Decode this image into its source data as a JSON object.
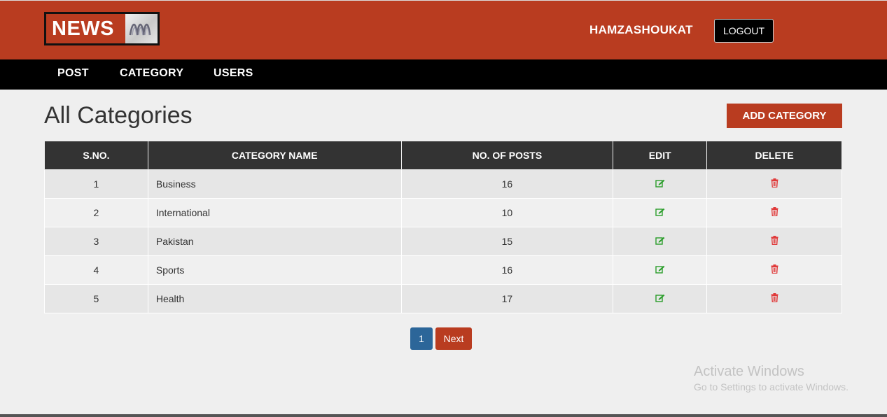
{
  "header": {
    "logo_text": "NEWS",
    "logo_mark": "ABC-style ribbon logo",
    "username": "HAMZASHOUKAT",
    "logout_label": "LOGOUT",
    "brand_color": "#b93c20"
  },
  "nav": {
    "items": [
      {
        "label": "POST"
      },
      {
        "label": "CATEGORY"
      },
      {
        "label": "USERS"
      }
    ]
  },
  "main": {
    "title": "All Categories",
    "add_button_label": "ADD CATEGORY",
    "table": {
      "columns": [
        "S.NO.",
        "CATEGORY NAME",
        "NO. OF POSTS",
        "EDIT",
        "DELETE"
      ],
      "rows": [
        {
          "sno": "1",
          "name": "Business",
          "posts": "16"
        },
        {
          "sno": "2",
          "name": "International",
          "posts": "10"
        },
        {
          "sno": "3",
          "name": "Pakistan",
          "posts": "15"
        },
        {
          "sno": "4",
          "name": "Sports",
          "posts": "16"
        },
        {
          "sno": "5",
          "name": "Health",
          "posts": "17"
        }
      ],
      "edit_icon": "edit-icon",
      "delete_icon": "trash-icon"
    },
    "pagination": {
      "current_page": "1",
      "next_label": "Next",
      "active_color": "#2c6699"
    }
  },
  "watermark": {
    "title": "Activate Windows",
    "subtitle": "Go to Settings to activate Windows."
  }
}
